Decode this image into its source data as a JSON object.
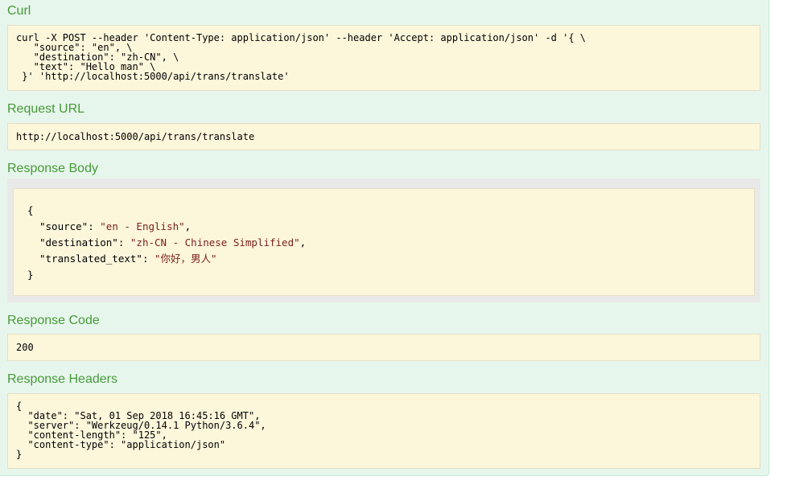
{
  "curl": {
    "heading": "Curl",
    "lines": [
      "curl -X POST --header 'Content-Type: application/json' --header 'Accept: application/json' -d '{ \\",
      "   \"source\": \"en\", \\",
      "   \"destination\": \"zh-CN\", \\",
      "   \"text\": \"Hello man\" \\",
      " }' 'http://localhost:5000/api/trans/translate'"
    ]
  },
  "request_url": {
    "heading": "Request URL",
    "value": "http://localhost:5000/api/trans/translate"
  },
  "response_body": {
    "heading": "Response Body",
    "open_brace": "{",
    "close_brace": "}",
    "fields": [
      {
        "key": "\"source\"",
        "sep": ": ",
        "value": "\"en - English\"",
        "trail": ","
      },
      {
        "key": "\"destination\"",
        "sep": ": ",
        "value": "\"zh-CN - Chinese Simplified\"",
        "trail": ","
      },
      {
        "key": "\"translated_text\"",
        "sep": ": ",
        "value": "\"你好，男人\"",
        "trail": ""
      }
    ]
  },
  "response_code": {
    "heading": "Response Code",
    "value": "200"
  },
  "response_headers": {
    "heading": "Response Headers",
    "lines": [
      "{",
      "  \"date\": \"Sat, 01 Sep 2018 16:45:16 GMT\",",
      "  \"server\": \"Werkzeug/0.14.1 Python/3.6.4\",",
      "  \"content-length\": \"125\",",
      "  \"content-type\": \"application/json\"",
      "}"
    ]
  }
}
